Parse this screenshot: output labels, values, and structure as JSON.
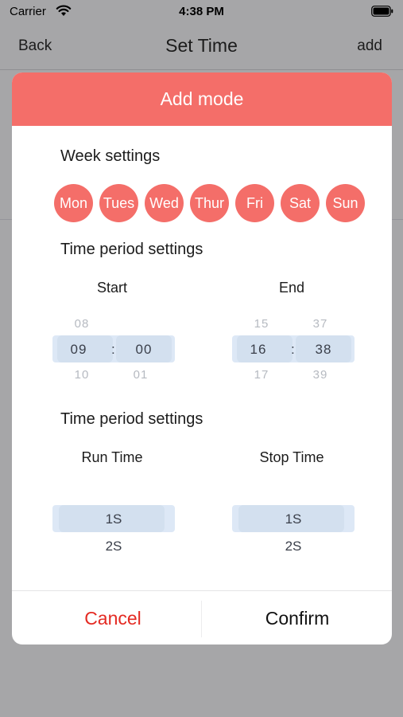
{
  "status_bar": {
    "carrier": "Carrier",
    "time": "4:38 PM"
  },
  "nav": {
    "back_label": "Back",
    "title": "Set Time",
    "add_label": "add"
  },
  "modal": {
    "title": "Add mode",
    "week_section_title": "Week settings",
    "days": [
      "Mon",
      "Tues",
      "Wed",
      "Thur",
      "Fri",
      "Sat",
      "Sun"
    ],
    "time_section_title": "Time period settings",
    "start": {
      "label": "Start",
      "hour": {
        "prev": "08",
        "selected": "09",
        "next": "10"
      },
      "minute": {
        "prev": "",
        "selected": "00",
        "next": "01"
      }
    },
    "end": {
      "label": "End",
      "hour": {
        "prev": "15",
        "selected": "16",
        "next": "17"
      },
      "minute": {
        "prev": "37",
        "selected": "38",
        "next": "39"
      }
    },
    "run_section_title": "Time period settings",
    "run_time": {
      "label": "Run Time",
      "selected": "1S",
      "next": "2S"
    },
    "stop_time": {
      "label": "Stop Time",
      "selected": "1S",
      "next": "2S"
    },
    "colon": ":",
    "cancel_label": "Cancel",
    "confirm_label": "Confirm"
  },
  "colors": {
    "accent": "#f46e69",
    "cancel": "#e42a22",
    "picker_highlight": "#d3e0ef"
  },
  "icons": {
    "wifi": "wifi-icon",
    "battery": "battery-icon"
  }
}
